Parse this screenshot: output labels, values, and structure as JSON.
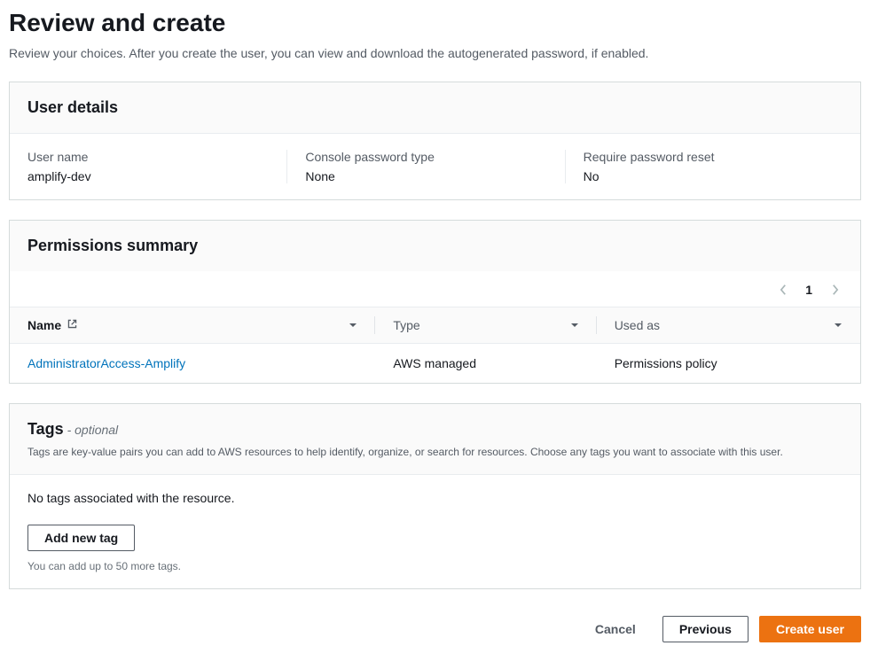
{
  "page": {
    "title": "Review and create",
    "subtitle": "Review your choices. After you create the user, you can view and download the autogenerated password, if enabled."
  },
  "user_details": {
    "heading": "User details",
    "fields": {
      "username_label": "User name",
      "username_value": "amplify-dev",
      "pwd_type_label": "Console password type",
      "pwd_type_value": "None",
      "reset_label": "Require password reset",
      "reset_value": "No"
    }
  },
  "permissions": {
    "heading": "Permissions summary",
    "page_num": "1",
    "columns": {
      "name": "Name",
      "type": "Type",
      "used_as": "Used as"
    },
    "row": {
      "name": "AdministratorAccess-Amplify",
      "type": "AWS managed",
      "used_as": "Permissions policy"
    }
  },
  "tags": {
    "heading": "Tags",
    "optional": " - optional",
    "description": "Tags are key-value pairs you can add to AWS resources to help identify, organize, or search for resources. Choose any tags you want to associate with this user.",
    "empty": "No tags associated with the resource.",
    "add_btn": "Add new tag",
    "hint": "You can add up to 50 more tags."
  },
  "footer": {
    "cancel": "Cancel",
    "previous": "Previous",
    "create": "Create user"
  }
}
